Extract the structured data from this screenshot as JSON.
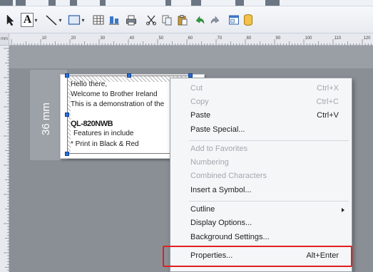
{
  "toolbar": {
    "tools": [
      {
        "icon": "pointer-arrow-icon"
      },
      {
        "icon": "text-tool-icon",
        "glyph": "A"
      },
      {
        "icon": "line-tool-icon"
      },
      {
        "icon": "rectangle-tool-icon"
      },
      {
        "icon": "table-tool-icon"
      },
      {
        "icon": "align-icon"
      },
      {
        "icon": "print-icon"
      },
      {
        "icon": "cut-icon"
      },
      {
        "icon": "copy-icon"
      },
      {
        "icon": "paste-icon"
      },
      {
        "icon": "undo-icon"
      },
      {
        "icon": "redo-icon"
      },
      {
        "icon": "window-icon"
      },
      {
        "icon": "database-icon"
      }
    ],
    "dropdown_glyph": "▾"
  },
  "ruler": {
    "corner_unit": "mm",
    "marks": [
      "10",
      "20",
      "30",
      "40",
      "50",
      "60",
      "70",
      "80",
      "90",
      "100",
      "110",
      "120"
    ]
  },
  "tape": {
    "width_label": "36 mm"
  },
  "label": {
    "lines": [
      {
        "text": "Hello there,",
        "bold": false
      },
      {
        "text": "Welcome to Brother Ireland",
        "bold": false
      },
      {
        "text": "This is a demonstration of the",
        "bold": false
      },
      {
        "text": "QL-820NWB",
        "bold": true
      },
      {
        "text": "Features in include",
        "bold": false
      },
      {
        "text": "* Print in Black & Red",
        "bold": false
      }
    ]
  },
  "context_menu": {
    "items": [
      {
        "label": "Cut",
        "shortcut": "Ctrl+X",
        "enabled": false
      },
      {
        "label": "Copy",
        "shortcut": "Ctrl+C",
        "enabled": false
      },
      {
        "label": "Paste",
        "shortcut": "Ctrl+V",
        "enabled": true
      },
      {
        "label": "Paste Special...",
        "shortcut": "",
        "enabled": true
      },
      {
        "label": "Add to Favorites",
        "shortcut": "",
        "enabled": false
      },
      {
        "label": "Numbering",
        "shortcut": "",
        "enabled": false
      },
      {
        "label": "Combined Characters",
        "shortcut": "",
        "enabled": false
      },
      {
        "label": "Insert a Symbol...",
        "shortcut": "",
        "enabled": true
      },
      {
        "label": "Cutline",
        "shortcut": "",
        "enabled": true,
        "submenu": true
      },
      {
        "label": "Display Options...",
        "shortcut": "",
        "enabled": true
      },
      {
        "label": "Background Settings...",
        "shortcut": "",
        "enabled": true
      },
      {
        "label": "Properties...",
        "shortcut": "Alt+Enter",
        "enabled": true,
        "highlighted": true
      }
    ]
  },
  "colors": {
    "highlight_box": "#e0201f",
    "selection_handle": "#2a6fd6",
    "canvas": "#8a8f95"
  }
}
